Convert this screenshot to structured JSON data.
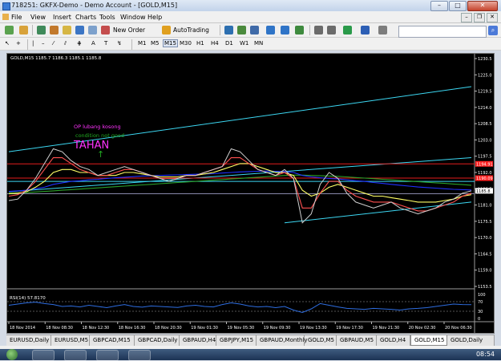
{
  "window": {
    "title": "718251: GKFX-Demo - Demo Account - [GOLD,M15]"
  },
  "menu": [
    "File",
    "View",
    "Insert",
    "Charts",
    "Tools",
    "Window",
    "Help"
  ],
  "toolbar": {
    "new_order": "New Order",
    "auto_trading": "AutoTrading",
    "search_placeholder": ""
  },
  "timeframes": [
    "M1",
    "M5",
    "M15",
    "M30",
    "H1",
    "H4",
    "D1",
    "W1",
    "MN"
  ],
  "active_timeframe": "M15",
  "chart_header": "GOLD,M15  1185.7 1186.3 1185.1 1185.8",
  "annotations": {
    "op": "OP lubang kosong",
    "condition": "condition not good",
    "tahan": "TAHAN",
    "arrow": "↑"
  },
  "rsi_label": "RSI(14) 57.8170",
  "rsi_levels": [
    "100",
    "70",
    "30",
    "0"
  ],
  "price_axis": [
    "1230.5",
    "1225.0",
    "1219.5",
    "1214.0",
    "1208.5",
    "1203.0",
    "1197.5",
    "1192.0",
    "1186.5",
    "1181.0",
    "1175.5",
    "1170.0",
    "1164.5",
    "1159.0",
    "1153.5"
  ],
  "price_tags": [
    {
      "text": "1194.91",
      "color": "#ff2020"
    },
    {
      "text": "1190.09",
      "color": "#ff2020"
    },
    {
      "text": "1185.8",
      "color": "#ffffff"
    }
  ],
  "time_axis": [
    "18 Nov 2014",
    "18 Nov 08:30",
    "18 Nov 12:30",
    "18 Nov 16:30",
    "18 Nov 20:30",
    "19 Nov 01:30",
    "19 Nov 05:30",
    "19 Nov 09:30",
    "19 Nov 13:30",
    "19 Nov 17:30",
    "19 Nov 21:30",
    "20 Nov 02:30",
    "20 Nov 06:30"
  ],
  "tabs": [
    "EURUSD,Daily",
    "EURUSD,M5",
    "GBPCAD,M15",
    "GBPCAD,Daily",
    "GBPAUD,H4",
    "GBPJPY,M15",
    "GBPAUD,Monthly",
    "GOLD,M5",
    "GBPAUD,M5",
    "GOLD,H4",
    "GOLD,M15",
    "GOLD,Daily"
  ],
  "active_tab": "GOLD,M15",
  "clock": "08:54",
  "colors": {
    "channel": "#3cd7f2",
    "resistance": "#e21d1d",
    "price": "#d0d0d0",
    "ma_fast": "#ff5050",
    "ma_mid": "#ffff66",
    "ma_slow": "#2030ff",
    "ma_long": "#2aa02a",
    "rsi": "#2e6de0"
  },
  "chart_data": {
    "type": "line",
    "ylim": [
      1153.5,
      1230.5
    ],
    "xlabel": "",
    "ylabel": "",
    "series": [
      {
        "values": [
          1182.5,
          1183,
          1186,
          1190,
          1195,
          1200,
          1199,
          1196,
          1194,
          1193,
          1191,
          1192,
          1193,
          1194,
          1193,
          1192,
          1191,
          1190,
          1189,
          1190,
          1191,
          1191,
          1192,
          1193,
          1194,
          1200,
          1199,
          1196,
          1193,
          1192,
          1191,
          1193,
          1190,
          1175,
          1178,
          1188,
          1192,
          1190,
          1185,
          1182,
          1181,
          1180,
          1181,
          1182,
          1180,
          1179,
          1178,
          1179,
          1180,
          1182,
          1183,
          1185,
          1185.8
        ]
      },
      {
        "values": [
          1184,
          1184.5,
          1186,
          1189,
          1193,
          1197,
          1197,
          1195,
          1193,
          1192,
          1191,
          1191,
          1192,
          1193,
          1193,
          1192,
          1191,
          1190,
          1190,
          1190,
          1191,
          1191,
          1192,
          1193,
          1194,
          1197,
          1197,
          1195,
          1193,
          1192,
          1191,
          1192,
          1190,
          1180,
          1180,
          1185,
          1189,
          1189,
          1186,
          1184,
          1183,
          1182,
          1182,
          1182,
          1181,
          1180,
          1179,
          1179,
          1180,
          1181,
          1182,
          1184,
          1185
        ]
      },
      {
        "values": [
          1184.8,
          1185,
          1185.5,
          1187,
          1189,
          1192,
          1193,
          1193,
          1192,
          1192,
          1191,
          1191,
          1191,
          1192,
          1192,
          1191.5,
          1191,
          1190.5,
          1190.5,
          1190.5,
          1191,
          1191,
          1191.5,
          1192,
          1193,
          1194,
          1195,
          1195,
          1194,
          1193,
          1192,
          1192,
          1191,
          1186,
          1184,
          1185,
          1187,
          1188,
          1187,
          1186,
          1185,
          1184,
          1184,
          1183.5,
          1183,
          1182.5,
          1182,
          1182,
          1182,
          1182.5,
          1183,
          1184,
          1184.5
        ]
      },
      {
        "values": [
          1185.6,
          1185.8,
          1186,
          1186.5,
          1187,
          1188,
          1188.5,
          1189,
          1189.2,
          1189.5,
          1189.7,
          1190,
          1190.2,
          1190.4,
          1190.6,
          1190.8,
          1190.9,
          1191,
          1191.1,
          1191.2,
          1191.3,
          1191.4,
          1191.5,
          1191.6,
          1191.8,
          1192,
          1192.2,
          1192.3,
          1192.4,
          1192.5,
          1192.4,
          1192.3,
          1192,
          1191,
          1190.5,
          1190.2,
          1190,
          1189.8,
          1189.5,
          1189.2,
          1189,
          1188.6,
          1188.3,
          1188,
          1187.7,
          1187.4,
          1187.1,
          1186.9,
          1186.7,
          1186.5,
          1186.3,
          1186.2,
          1186.1
        ]
      },
      {
        "values": [
          1185,
          1185.1,
          1185.2,
          1185.4,
          1185.6,
          1185.8,
          1186,
          1186.2,
          1186.4,
          1186.6,
          1186.8,
          1187,
          1187.2,
          1187.4,
          1187.6,
          1187.8,
          1188,
          1188.2,
          1188.4,
          1188.6,
          1188.8,
          1189,
          1189.2,
          1189.4,
          1189.6,
          1189.8,
          1190,
          1190.2,
          1190.4,
          1190.6,
          1190.8,
          1191,
          1191.1,
          1191.1,
          1191,
          1190.9,
          1190.8,
          1190.7,
          1190.5,
          1190.3,
          1190.1,
          1189.9,
          1189.7,
          1189.5,
          1189.3,
          1189.1,
          1188.9,
          1188.7,
          1188.5,
          1188.3,
          1188.1,
          1187.9,
          1187.7
        ]
      }
    ],
    "rsi": [
      55,
      60,
      65,
      68,
      62,
      58,
      50,
      52,
      48,
      55,
      50,
      45,
      52,
      58,
      50,
      47,
      52,
      50,
      48,
      46,
      52,
      55,
      50,
      48,
      58,
      65,
      60,
      52,
      48,
      50,
      45,
      50,
      35,
      25,
      40,
      62,
      55,
      48,
      42,
      40,
      38,
      42,
      40,
      38,
      35,
      40,
      42,
      45,
      50,
      55,
      60,
      58,
      57.8
    ],
    "levels": [
      {
        "value": 1194.91,
        "color": "#e21d1d"
      },
      {
        "value": 1190.09,
        "color": "#e21d1d"
      },
      {
        "value": 1189.0,
        "color": "#3cd7f2"
      },
      {
        "value": 1184.8,
        "color": "#8888aa"
      }
    ],
    "trendlines": [
      {
        "from": [
          0,
          1199
        ],
        "to": [
          52,
          1221
        ]
      },
      {
        "from": [
          0,
          1185.5
        ],
        "to": [
          52,
          1197
        ]
      },
      {
        "from": [
          31,
          1175
        ],
        "to": [
          52,
          1182
        ]
      }
    ]
  }
}
